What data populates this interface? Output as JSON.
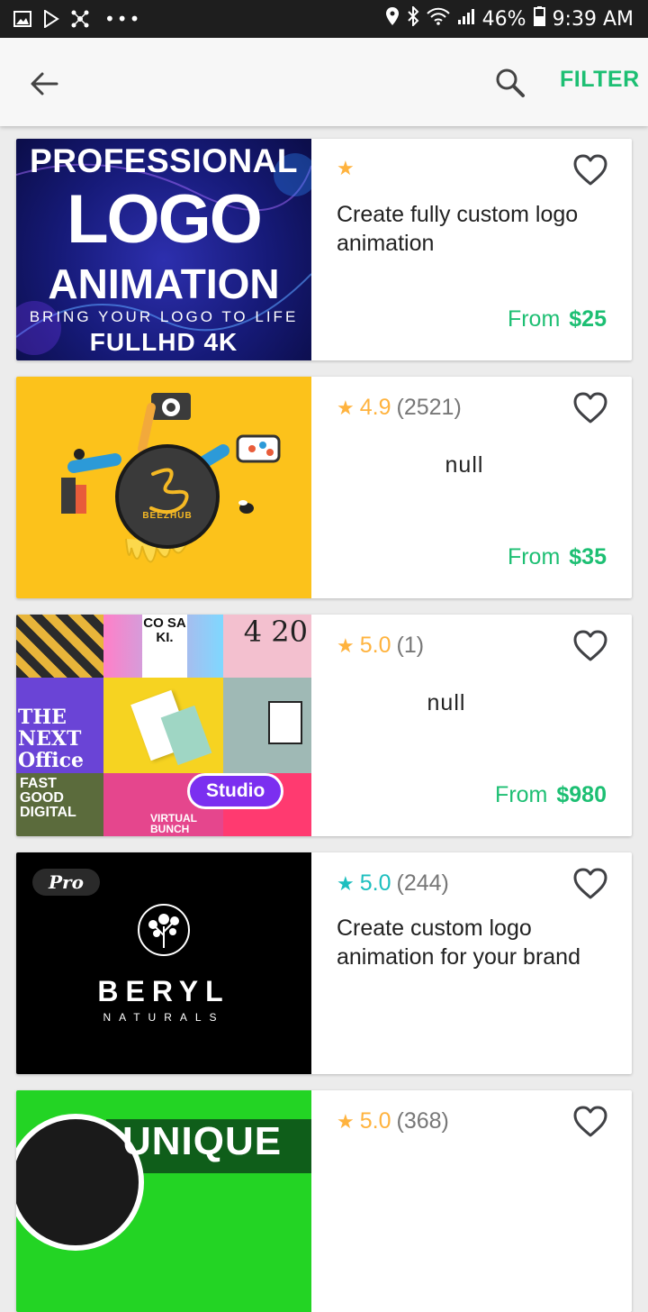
{
  "status_bar": {
    "battery": "46%",
    "time": "9:39 AM",
    "dots": "•••"
  },
  "app_bar": {
    "filter_label": "FILTER"
  },
  "colors": {
    "accent": "#1dbf73",
    "star": "#ffb33e",
    "star_pro": "#1dbfbf"
  },
  "gigs": [
    {
      "thumb": {
        "line1": "PROFESSIONAL",
        "line2": "LOGO",
        "line3": "ANIMATION",
        "line4": "BRING YOUR LOGO TO LIFE",
        "line5": "FULLHD 4K"
      },
      "rating_value": "",
      "rating_count": "",
      "title": "Create fully custom logo animation",
      "price_prefix": "From",
      "price": "$25"
    },
    {
      "thumb": {
        "brand": "BEEZHUB"
      },
      "rating_value": "4.9",
      "rating_count": "(2521)",
      "title": "null",
      "price_prefix": "From",
      "price": "$35"
    },
    {
      "thumb": {
        "tile1": "CO SA KI.",
        "tile2": "4 20",
        "tile3": "THE NEXT Office",
        "tile4": "FAST GOOD DIGITAL",
        "tile5": "VIRTUAL BUNCH",
        "badge": "Studio"
      },
      "rating_value": "5.0",
      "rating_count": "(1)",
      "title": "null",
      "price_prefix": "From",
      "price": "$980"
    },
    {
      "thumb": {
        "badge": "Pro",
        "brand": "BERYL",
        "sub": "NATURALS"
      },
      "rating_value": "5.0",
      "rating_count": "(244)",
      "title": "Create custom logo animation for your brand",
      "price_prefix": "",
      "price": ""
    },
    {
      "thumb": {
        "text": "UNIQUE"
      },
      "rating_value": "5.0",
      "rating_count": "(368)",
      "title": "",
      "price_prefix": "",
      "price": ""
    }
  ]
}
